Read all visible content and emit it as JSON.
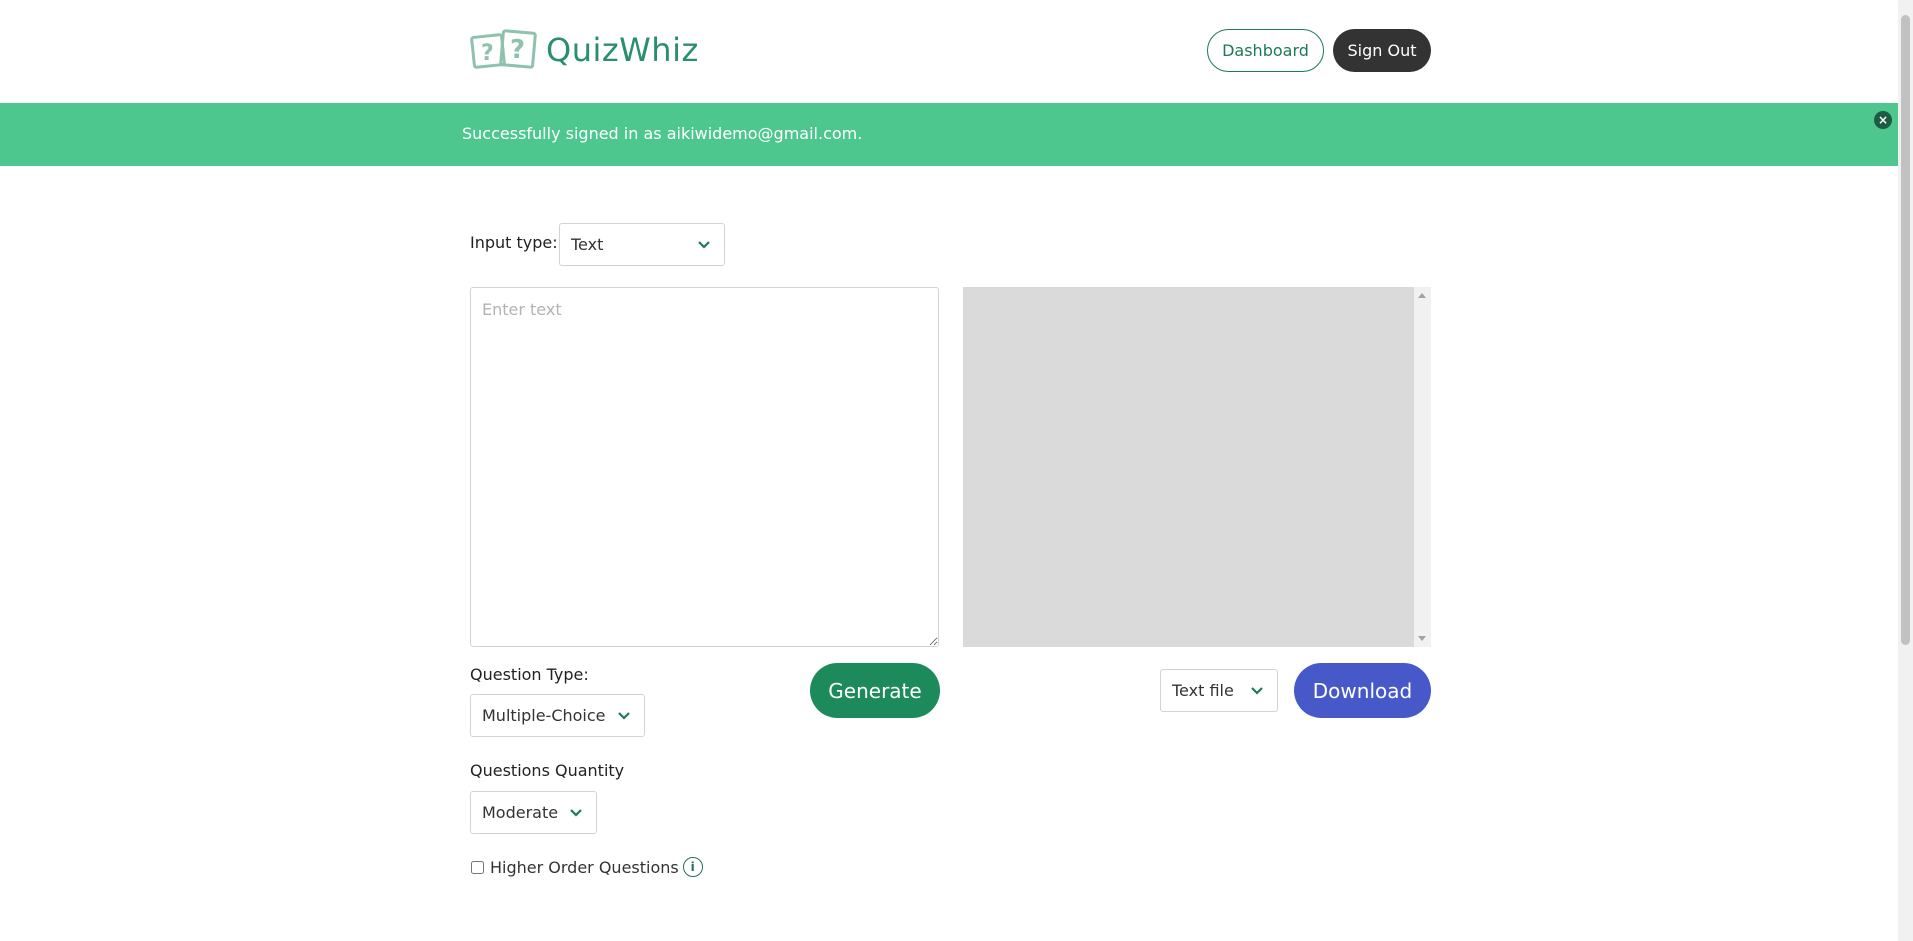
{
  "header": {
    "logo_text": "QuizWhiz",
    "dashboard_label": "Dashboard",
    "signout_label": "Sign Out"
  },
  "flash": {
    "message": "Successfully signed in as aikiwidemo@gmail.com.",
    "close_glyph": "×"
  },
  "form": {
    "input_type_label": "Input type:",
    "input_type_value": "Text",
    "text_placeholder": "Enter text",
    "question_type_label": "Question Type:",
    "question_type_value": "Multiple-Choice",
    "generate_label": "Generate",
    "quantity_label": "Questions Quantity",
    "quantity_value": "Moderate",
    "higher_order_label": "Higher Order Questions",
    "info_glyph": "i"
  },
  "output": {
    "format_value": "Text file",
    "download_label": "Download"
  },
  "colors": {
    "brand_green": "#1d8a5b",
    "flash_green": "#4ec78f",
    "download_blue": "#4759c9",
    "dark_button": "#333333"
  }
}
